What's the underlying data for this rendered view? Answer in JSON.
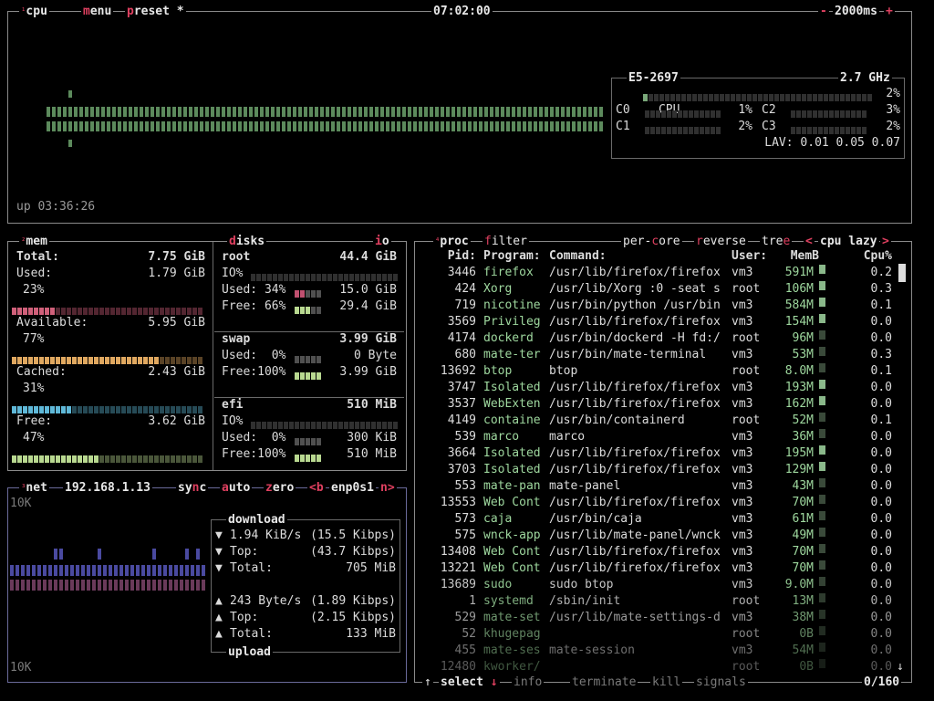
{
  "cpu_box": {
    "title": "cpu",
    "menu": "menu",
    "preset": "preset *",
    "clock": "07:02:00",
    "minus": "-",
    "interval": "2000ms",
    "plus": "+",
    "uptime": "up 03:36:26",
    "cpu_name": "E5-2697",
    "freq": "2.7 GHz",
    "total_label": "CPU",
    "total_pct": "2%",
    "cores": [
      {
        "label": "C0",
        "pct": "1%"
      },
      {
        "label": "C1",
        "pct": "2%"
      },
      {
        "label": "C2",
        "pct": "3%"
      },
      {
        "label": "C3",
        "pct": "2%"
      }
    ],
    "lav": "LAV: 0.01 0.05 0.07"
  },
  "mem_box": {
    "title": "mem",
    "total_label": "Total:",
    "total_value": "7.75 GiB",
    "used_label": "Used:",
    "used_value": "1.79 GiB",
    "used_pct": "23%",
    "available_label": "Available:",
    "available_value": "5.95 GiB",
    "available_pct": "77%",
    "cached_label": "Cached:",
    "cached_value": "2.43 GiB",
    "cached_pct": "31%",
    "free_label": "Free:",
    "free_value": "3.62 GiB",
    "free_pct": "47%",
    "colors": {
      "used": "#d0607a",
      "available": "#e0a860",
      "cached": "#5fb8d8",
      "free": "#b8d890"
    }
  },
  "disks_box": {
    "title": "disks",
    "io": "io",
    "disks": [
      {
        "name": "root",
        "size": "44.4 GiB",
        "io_label": "IO%",
        "used_label": "Used: 34%",
        "used_value": "15.0 GiB",
        "free_label": "Free: 66%",
        "free_value": "29.4 GiB",
        "used": 0.34,
        "free": 0.66
      },
      {
        "name": "swap",
        "size": "3.99 GiB",
        "used_label": "Used:  0%",
        "used_value": "0 Byte",
        "free_label": "Free:100%",
        "free_value": "3.99 GiB",
        "used": 0.0,
        "free": 1.0
      },
      {
        "name": "efi",
        "size": "510 MiB",
        "io_label": "IO%",
        "used_label": "Used:  0%",
        "used_value": "300 KiB",
        "free_label": "Free:100%",
        "free_value": "510 MiB",
        "used": 0.0,
        "free": 1.0
      }
    ]
  },
  "net_box": {
    "title": "net",
    "ip": "192.168.1.13",
    "sync": "sync",
    "auto": "auto",
    "zero": "zero",
    "iface_prev": "<b",
    "iface": "enp0s1",
    "iface_next": "n>",
    "scale_top": "10K",
    "scale_bottom": "10K",
    "download_title": "download",
    "upload_title": "upload",
    "down": [
      {
        "arrow": "▼",
        "label": "1.94 KiB/s",
        "value": "(15.5 Kibps)"
      },
      {
        "arrow": "▼",
        "label": "Top:",
        "value": "(43.7 Kibps)"
      },
      {
        "arrow": "▼",
        "label": "Total:",
        "value": "705 MiB"
      }
    ],
    "up": [
      {
        "arrow": "▲",
        "label": "243 Byte/s",
        "value": "(1.89 Kibps)"
      },
      {
        "arrow": "▲",
        "label": "Top:",
        "value": "(2.15 Kibps)"
      },
      {
        "arrow": "▲",
        "label": "Total:",
        "value": "133 MiB"
      }
    ]
  },
  "proc_box": {
    "title": "proc",
    "filter": "filter",
    "per_core": "per-core",
    "reverse": "reverse",
    "tree": "tree",
    "sort_prev": "<",
    "sort": "cpu lazy",
    "sort_next": ">",
    "headers": {
      "pid": "Pid:",
      "program": "Program:",
      "command": "Command:",
      "user": "User:",
      "mem": "MemB",
      "cpu": "Cpu%"
    },
    "rows": [
      {
        "pid": "3446",
        "program": "firefox",
        "command": "/usr/lib/firefox/firefox",
        "user": "vm3",
        "mem": "591M",
        "cpu": "0.2"
      },
      {
        "pid": "424",
        "program": "Xorg",
        "command": "/usr/lib/Xorg :0 -seat s",
        "user": "root",
        "mem": "106M",
        "cpu": "0.3"
      },
      {
        "pid": "719",
        "program": "nicotine",
        "command": "/usr/bin/python /usr/bin",
        "user": "vm3",
        "mem": "584M",
        "cpu": "0.1"
      },
      {
        "pid": "3569",
        "program": "Privileg",
        "command": "/usr/lib/firefox/firefox",
        "user": "vm3",
        "mem": "154M",
        "cpu": "0.0"
      },
      {
        "pid": "4174",
        "program": "dockerd",
        "command": "/usr/bin/dockerd -H fd:/",
        "user": "root",
        "mem": "96M",
        "cpu": "0.0"
      },
      {
        "pid": "680",
        "program": "mate-ter",
        "command": "/usr/bin/mate-terminal",
        "user": "vm3",
        "mem": "53M",
        "cpu": "0.3"
      },
      {
        "pid": "13692",
        "program": "btop",
        "command": "btop",
        "user": "root",
        "mem": "8.0M",
        "cpu": "0.1"
      },
      {
        "pid": "3747",
        "program": "Isolated",
        "command": "/usr/lib/firefox/firefox",
        "user": "vm3",
        "mem": "193M",
        "cpu": "0.0"
      },
      {
        "pid": "3537",
        "program": "WebExten",
        "command": "/usr/lib/firefox/firefox",
        "user": "vm3",
        "mem": "162M",
        "cpu": "0.0"
      },
      {
        "pid": "4149",
        "program": "containe",
        "command": "/usr/bin/containerd",
        "user": "root",
        "mem": "52M",
        "cpu": "0.1"
      },
      {
        "pid": "539",
        "program": "marco",
        "command": "marco",
        "user": "vm3",
        "mem": "36M",
        "cpu": "0.0"
      },
      {
        "pid": "3664",
        "program": "Isolated",
        "command": "/usr/lib/firefox/firefox",
        "user": "vm3",
        "mem": "195M",
        "cpu": "0.0"
      },
      {
        "pid": "3703",
        "program": "Isolated",
        "command": "/usr/lib/firefox/firefox",
        "user": "vm3",
        "mem": "129M",
        "cpu": "0.0"
      },
      {
        "pid": "553",
        "program": "mate-pan",
        "command": "mate-panel",
        "user": "vm3",
        "mem": "43M",
        "cpu": "0.0"
      },
      {
        "pid": "13553",
        "program": "Web Cont",
        "command": "/usr/lib/firefox/firefox",
        "user": "vm3",
        "mem": "70M",
        "cpu": "0.0"
      },
      {
        "pid": "573",
        "program": "caja",
        "command": "/usr/bin/caja",
        "user": "vm3",
        "mem": "61M",
        "cpu": "0.0"
      },
      {
        "pid": "575",
        "program": "wnck-app",
        "command": "/usr/lib/mate-panel/wnck",
        "user": "vm3",
        "mem": "49M",
        "cpu": "0.0"
      },
      {
        "pid": "13408",
        "program": "Web Cont",
        "command": "/usr/lib/firefox/firefox",
        "user": "vm3",
        "mem": "70M",
        "cpu": "0.0"
      },
      {
        "pid": "13221",
        "program": "Web Cont",
        "command": "/usr/lib/firefox/firefox",
        "user": "vm3",
        "mem": "70M",
        "cpu": "0.0"
      },
      {
        "pid": "13689",
        "program": "sudo",
        "command": "sudo btop",
        "user": "vm3",
        "mem": "9.0M",
        "cpu": "0.0"
      },
      {
        "pid": "1",
        "program": "systemd",
        "command": "/sbin/init",
        "user": "root",
        "mem": "13M",
        "cpu": "0.0"
      },
      {
        "pid": "529",
        "program": "mate-set",
        "command": "/usr/lib/mate-settings-d",
        "user": "vm3",
        "mem": "38M",
        "cpu": "0.0"
      },
      {
        "pid": "52",
        "program": "khugepag",
        "command": "",
        "user": "root",
        "mem": "0B",
        "cpu": "0.0"
      },
      {
        "pid": "455",
        "program": "mate-ses",
        "command": "mate-session",
        "user": "vm3",
        "mem": "54M",
        "cpu": "0.0"
      },
      {
        "pid": "12480",
        "program": "kworker/",
        "command": "",
        "user": "root",
        "mem": "0B",
        "cpu": "0.0"
      }
    ],
    "footer": {
      "up_arrow": "↑",
      "select": "select",
      "down_arrow": "↓",
      "info": "info",
      "terminate": "terminate",
      "kill": "kill",
      "signals": "signals",
      "count": "0/160"
    }
  }
}
